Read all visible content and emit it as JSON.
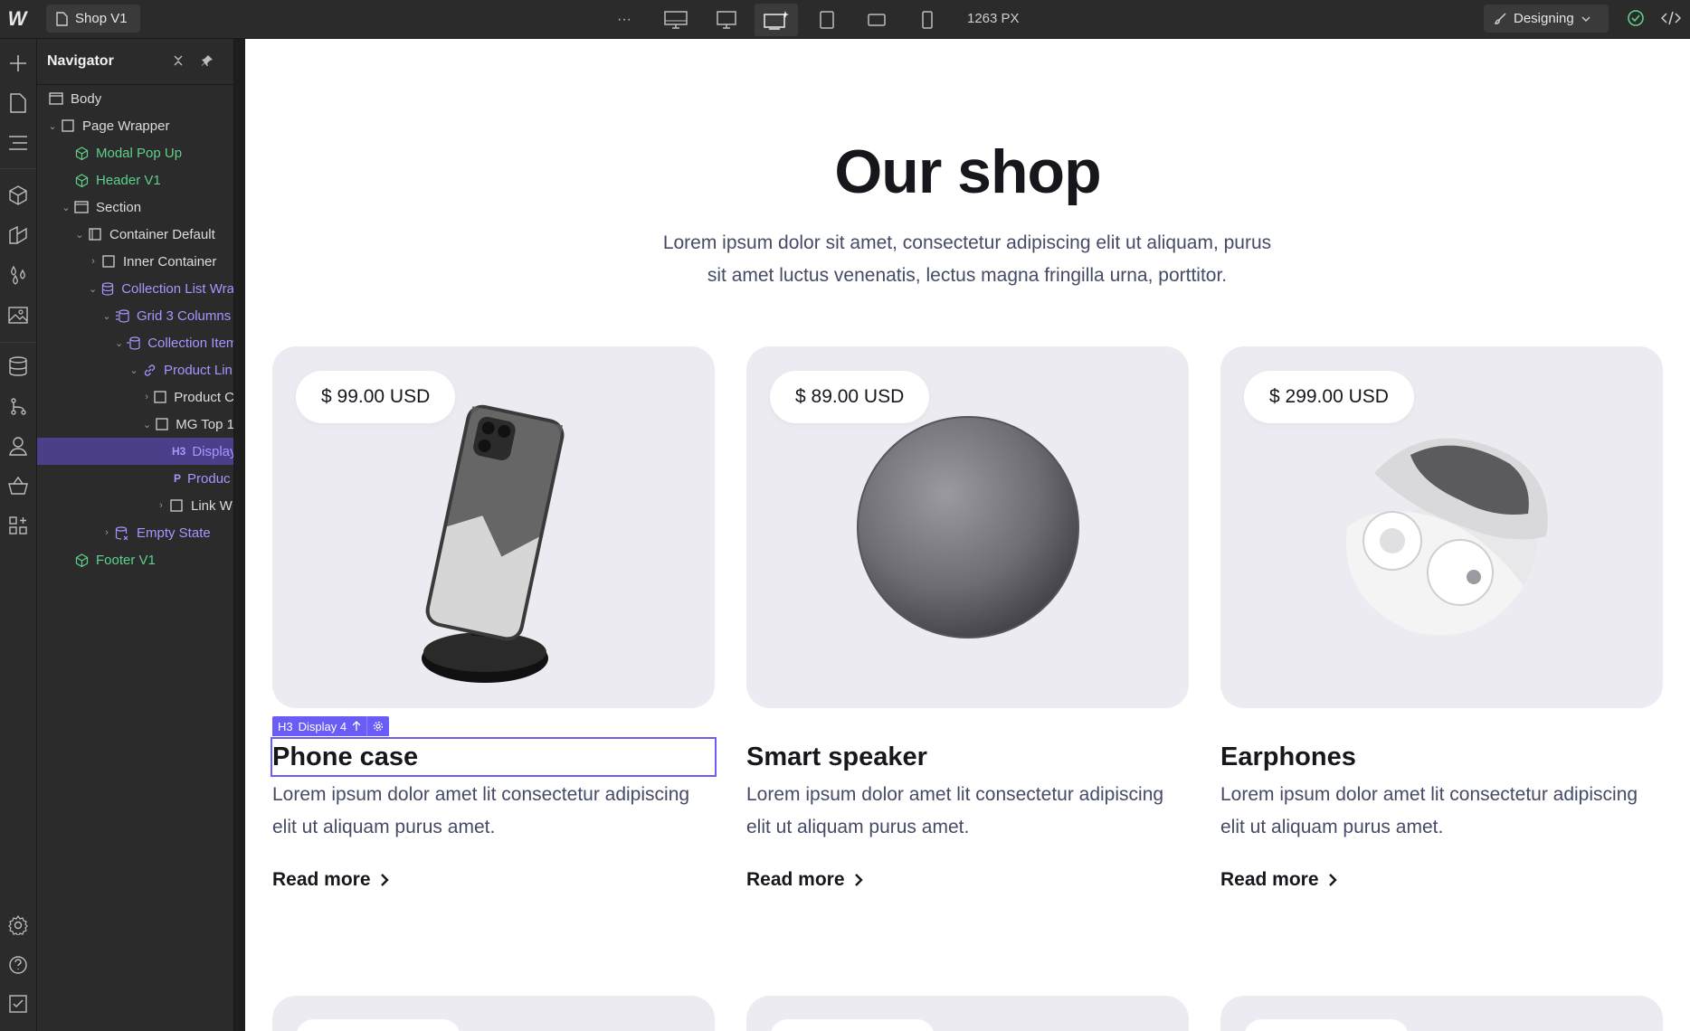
{
  "topbar": {
    "page_name": "Shop V1",
    "more_label": "···",
    "width_readout": "1263 PX",
    "mode_label": "Designing"
  },
  "navigator": {
    "title": "Navigator",
    "items": [
      {
        "label": "Body"
      },
      {
        "label": "Page Wrapper"
      },
      {
        "label": "Modal Pop Up"
      },
      {
        "label": "Header V1"
      },
      {
        "label": "Section"
      },
      {
        "label": "Container Default"
      },
      {
        "label": "Inner Container"
      },
      {
        "label": "Collection List Wra"
      },
      {
        "label": "Grid 3 Columns"
      },
      {
        "label": "Collection Item"
      },
      {
        "label": "Product Lin"
      },
      {
        "label": "Product C"
      },
      {
        "label": "MG Top 1"
      },
      {
        "label": "Display",
        "tag": "H3"
      },
      {
        "label": "Produc",
        "tag": "P"
      },
      {
        "label": "Link W"
      },
      {
        "label": "Empty State"
      },
      {
        "label": "Footer V1"
      }
    ]
  },
  "canvas": {
    "title": "Our shop",
    "subtitle_line1": "Lorem ipsum dolor sit amet, consectetur adipiscing elit ut aliquam, purus",
    "subtitle_line2": "sit amet luctus venenatis, lectus magna fringilla urna, porttitor.",
    "selection_tag": {
      "element": "H3",
      "class_name": "Display 4"
    },
    "products": [
      {
        "price": "$ 99.00 USD",
        "name": "Phone case",
        "desc_line1": "Lorem ipsum dolor amet lit consectetur adipiscing",
        "desc_line2": "elit ut aliquam purus amet.",
        "link": "Read more"
      },
      {
        "price": "$ 89.00 USD",
        "name": "Smart speaker",
        "desc_line1": "Lorem ipsum dolor amet lit consectetur adipiscing",
        "desc_line2": "elit ut aliquam purus amet.",
        "link": "Read more"
      },
      {
        "price": "$ 299.00 USD",
        "name": "Earphones",
        "desc_line1": "Lorem ipsum dolor amet lit consectetur adipiscing",
        "desc_line2": "elit ut aliquam purus amet.",
        "link": "Read more"
      }
    ]
  },
  "colors": {
    "accent": "#6a5cf6",
    "component": "#5ed08a",
    "cms": "#a796ff",
    "selected_row": "#4a3f88"
  }
}
